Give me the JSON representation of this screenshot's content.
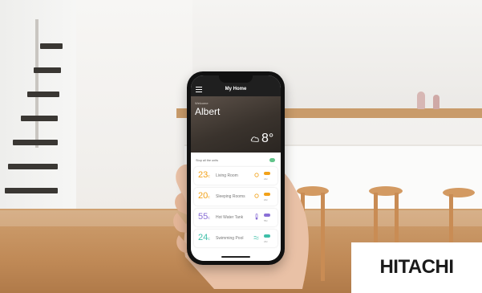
{
  "app": {
    "title": "My Home",
    "welcome": "Welcome",
    "user_name": "Albert",
    "weather_icon": "cloud-icon",
    "temperature": "8°"
  },
  "list": {
    "header": "Stop all the units"
  },
  "zones": [
    {
      "temp": "23",
      "unit": "c",
      "name": "Living Room",
      "color": "#f2a21a",
      "icon": "sun-icon",
      "sub": "22c"
    },
    {
      "temp": "20",
      "unit": "c",
      "name": "Sleeping Rooms",
      "color": "#f2a21a",
      "icon": "sun-icon",
      "sub": "20c"
    },
    {
      "temp": "55",
      "unit": "c",
      "name": "Hot Water Tank",
      "color": "#8a6fd6",
      "icon": "thermometer-icon",
      "sub": "55c"
    },
    {
      "temp": "24",
      "unit": "c",
      "name": "Swimming Pool",
      "color": "#3fbfa8",
      "icon": "waves-icon",
      "sub": "24c"
    }
  ],
  "brand": {
    "logo": "HITACHI"
  }
}
